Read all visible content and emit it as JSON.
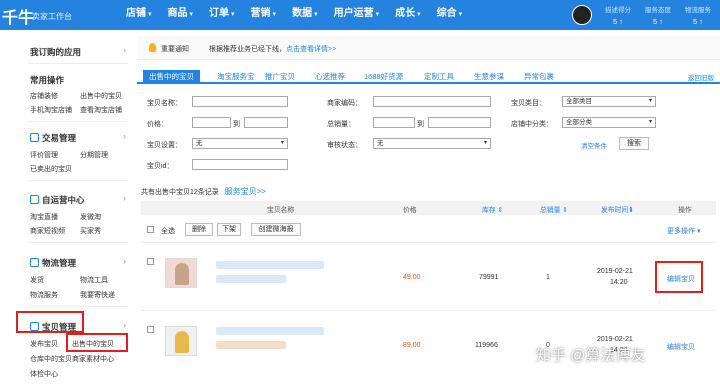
{
  "app": {
    "logo": "千牛",
    "subtitle": "卖家工作台"
  },
  "nav": {
    "items": [
      "店铺",
      "商品",
      "订单",
      "营销",
      "数据",
      "用户运营",
      "成长",
      "综合"
    ],
    "caret": "▾"
  },
  "metrics": [
    {
      "label": "描述得分",
      "value": "5 ↑"
    },
    {
      "label": "服务态度",
      "value": "5 ↑"
    },
    {
      "label": "物流服务",
      "value": "5 ↑"
    }
  ],
  "sidebar": {
    "my_apps": "我订购的应用",
    "common": "常用操作",
    "common_items": [
      "店铺装修",
      "出售中的宝贝",
      "手机淘宝店铺",
      "查看淘宝店铺"
    ],
    "trade": {
      "title": "交易管理",
      "items": [
        "评价管理",
        "分期管理",
        "已卖出的宝贝"
      ]
    },
    "marketing": {
      "title": "自运营中心",
      "items": [
        "淘宝直播",
        "发微淘",
        "商家短视频",
        "买家秀"
      ]
    },
    "logistics": {
      "title": "物流管理",
      "items": [
        "发货",
        "物流工具",
        "物流服务",
        "我要寄快递"
      ]
    },
    "goods": {
      "title": "宝贝管理",
      "items": [
        "发布宝贝",
        "出售中的宝贝",
        "仓库中的宝贝",
        "商家素材中心",
        "体检中心"
      ]
    },
    "arrow": "›"
  },
  "notice": {
    "label": "重要通知",
    "text": "根据推荐业务已经下线，",
    "link": "点击查看详情>>"
  },
  "tabs": [
    "出售中的宝贝",
    "淘宝服务宝",
    "推广宝贝",
    "心选推荐",
    "1688好货源",
    "定制工具",
    "生意参谋",
    "异常包裹"
  ],
  "back_link": "返回旧版",
  "filters": {
    "name": "宝贝名称：",
    "price": "价格：",
    "to": "到",
    "settings": "宝贝设置：",
    "settings_value": "无",
    "id": "宝贝id：",
    "code": "商家编码：",
    "sales": "总销量：",
    "audit": "审核状态：",
    "audit_value": "无",
    "category": "宝贝类目：",
    "category_value": "全部类目",
    "shop_category": "店铺中分类：",
    "shop_category_value": "全部分类",
    "clear": "清空条件",
    "search": "搜索",
    "dropdown": "▾"
  },
  "summary": {
    "text": "共有出售中宝贝12条记录",
    "link": "服务宝贝>>"
  },
  "columns": {
    "name": "宝贝名称",
    "price": "价格",
    "stock": "库存 ⇕",
    "sold": "总销量 ⇕",
    "time": "发布时间⬇",
    "action": "操作"
  },
  "toolbar": {
    "select_all": "全选",
    "delete": "删除",
    "unlist": "下架",
    "create": "创建微海报",
    "more": "更多操作 ▾"
  },
  "rows": [
    {
      "price": "49.00",
      "stock": "79991",
      "sold": "1",
      "date": "2019-02-21",
      "time": "14:20",
      "edit": "编辑宝贝"
    },
    {
      "price": "89.00",
      "stock": "119966",
      "sold": "0",
      "date": "2019-02-21",
      "time": "14:20",
      "edit": "编辑宝贝"
    }
  ],
  "watermark": "知乎 @算法博友",
  "colors": {
    "accent": "#2583e0",
    "highlight": "#e02020",
    "price": "#e4571c"
  }
}
